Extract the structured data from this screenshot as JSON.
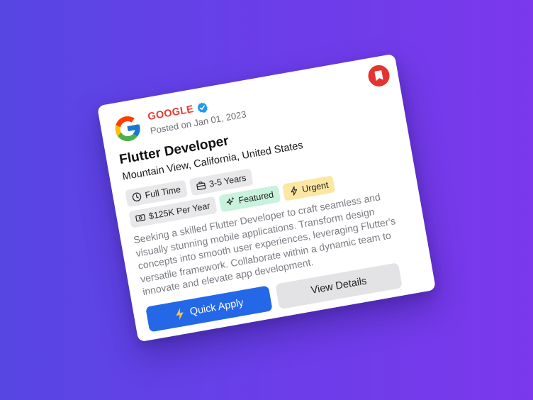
{
  "job": {
    "company": "GOOGLE",
    "posted": "Posted on Jan 01, 2023",
    "title": "Flutter Developer",
    "location": "Mountain View, California, United States",
    "tags": {
      "type": "Full Time",
      "experience": "3-5 Years",
      "salary": "$125K Per Year",
      "featured": "Featured",
      "urgent": "Urgent"
    },
    "description": "Seeking a skilled Flutter Developer to craft seamless and visually stunning mobile applications. Transform design concepts into smooth user experiences, leveraging Flutter's versatile framework. Collaborate within a dynamic team to innovate and elevate app development.",
    "actions": {
      "quick_apply": "Quick Apply",
      "view_details": "View Details"
    }
  },
  "icons": {
    "bookmark": "bookmark-icon",
    "verified": "verified-badge-icon",
    "clock": "clock-icon",
    "briefcase": "briefcase-icon",
    "money": "money-icon",
    "sparkle": "sparkle-icon",
    "bolt": "bolt-icon"
  },
  "colors": {
    "background_start": "#5746e3",
    "background_end": "#7b38ec",
    "company": "#e5392f",
    "bookmark": "#e3342f",
    "primary": "#2468e8",
    "featured": "#c8f2dc",
    "urgent": "#fbe7a2",
    "bolt": "#f5c33b"
  }
}
